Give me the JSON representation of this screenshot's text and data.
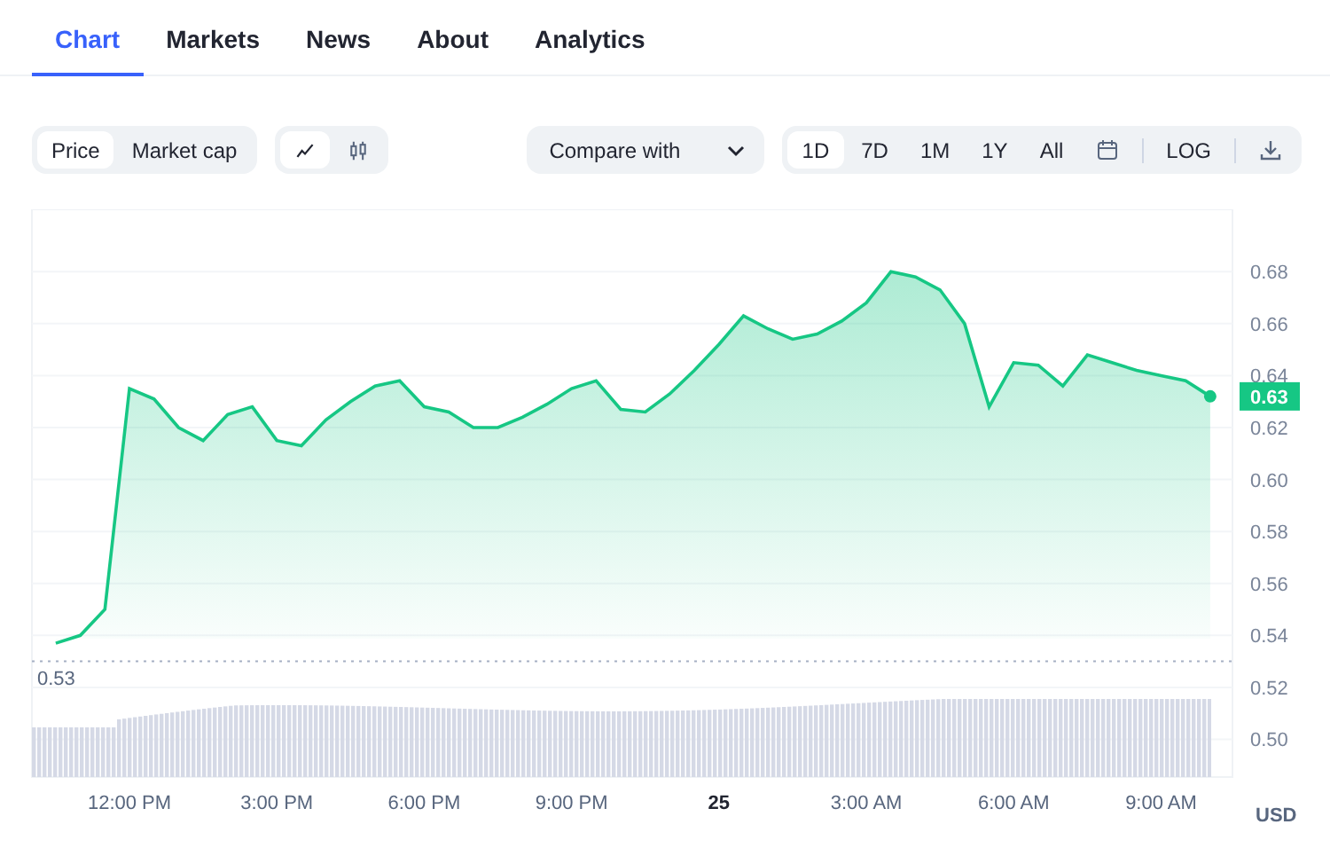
{
  "tabs": [
    {
      "label": "Chart",
      "selected": true
    },
    {
      "label": "Markets",
      "selected": false
    },
    {
      "label": "News",
      "selected": false
    },
    {
      "label": "About",
      "selected": false
    },
    {
      "label": "Analytics",
      "selected": false
    }
  ],
  "metric_toggle": [
    {
      "label": "Price",
      "selected": true
    },
    {
      "label": "Market cap",
      "selected": false
    }
  ],
  "chart_type_toggle": [
    {
      "kind": "line",
      "selected": true
    },
    {
      "kind": "candles",
      "selected": false
    }
  ],
  "compare": {
    "label": "Compare with"
  },
  "ranges": [
    {
      "label": "1D",
      "selected": true
    },
    {
      "label": "7D",
      "selected": false
    },
    {
      "label": "1M",
      "selected": false
    },
    {
      "label": "1Y",
      "selected": false
    },
    {
      "label": "All",
      "selected": false
    }
  ],
  "log": {
    "label": "LOG"
  },
  "chart": {
    "current_price": "0.63",
    "currency": "USD",
    "day_label": "25",
    "chart_data": {
      "type": "line",
      "ylim": [
        0.485,
        0.704
      ],
      "grid": true,
      "ref_lines": [
        {
          "axis": "y",
          "value": 0.53,
          "label": "0.53"
        }
      ],
      "categories": [
        null,
        null,
        null,
        "12:00 PM",
        null,
        null,
        null,
        null,
        null,
        "3:00 PM",
        null,
        null,
        null,
        null,
        null,
        "6:00 PM",
        null,
        null,
        null,
        null,
        null,
        "9:00 PM",
        null,
        null,
        null,
        null,
        null,
        null,
        null,
        null,
        null,
        null,
        null,
        "3:00 AM",
        null,
        null,
        null,
        null,
        null,
        "6:00 AM",
        null,
        null,
        null,
        null,
        null,
        "9:00 AM",
        null,
        null
      ],
      "series": [
        {
          "color": "#16c784",
          "values": [
            0.537,
            0.54,
            0.55,
            0.635,
            0.631,
            0.62,
            0.615,
            0.625,
            0.628,
            0.615,
            0.613,
            0.623,
            0.63,
            0.636,
            0.638,
            0.628,
            0.626,
            0.62,
            0.62,
            0.624,
            0.629,
            0.635,
            0.638,
            0.627,
            0.626,
            0.633,
            0.642,
            0.652,
            0.663,
            0.658,
            0.654,
            0.656,
            0.661,
            0.668,
            0.68,
            0.678,
            0.673,
            0.66,
            0.628,
            0.645,
            0.644,
            0.636,
            0.648,
            0.645,
            0.642,
            0.64,
            0.638,
            0.632
          ]
        }
      ],
      "yticks": [
        {
          "value": 0.5,
          "label": "0.50"
        },
        {
          "value": 0.52,
          "label": "0.52"
        },
        {
          "value": 0.54,
          "label": "0.54"
        },
        {
          "value": 0.56,
          "label": "0.56"
        },
        {
          "value": 0.58,
          "label": "0.58"
        },
        {
          "value": 0.6,
          "label": "0.60"
        },
        {
          "value": 0.62,
          "label": "0.62"
        },
        {
          "value": 0.64,
          "label": "0.64"
        },
        {
          "value": 0.66,
          "label": "0.66"
        },
        {
          "value": 0.68,
          "label": "0.68"
        }
      ]
    }
  }
}
